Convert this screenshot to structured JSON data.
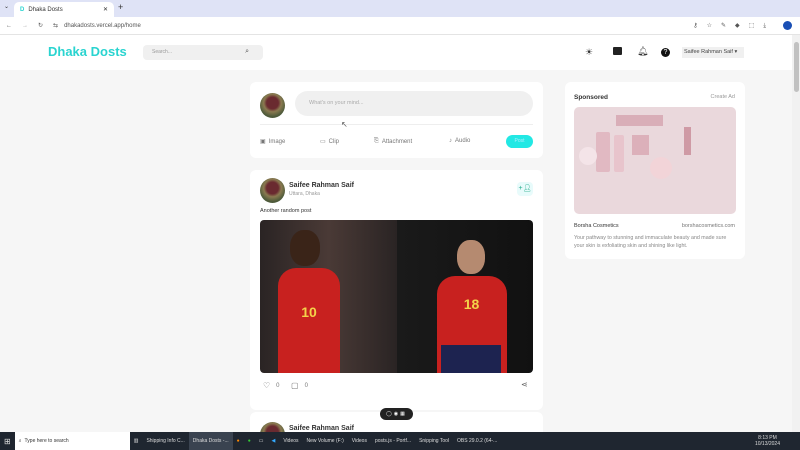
{
  "browser": {
    "tab_title": "Dhaka Dosts",
    "url": "dhakadosts.vercel.app/home"
  },
  "nav": {
    "logo": "Dhaka Dosts",
    "search_placeholder": "Search...",
    "user_name": "Saifee Rahman Saif"
  },
  "composer": {
    "placeholder": "What's on your mind...",
    "actions": [
      "Image",
      "Clip",
      "Attachment",
      "Audio"
    ],
    "post_label": "Post"
  },
  "posts": [
    {
      "author": "Saifee Rahman Saif",
      "location": "Uttara, Dhaka",
      "text": "Another random post",
      "likes": "0",
      "comments": "0"
    },
    {
      "author": "Saifee Rahman Saif"
    }
  ],
  "jersey_numbers": [
    "10",
    "18"
  ],
  "sponsored": {
    "title": "Sponsored",
    "create": "Create Ad",
    "brand": "Borsha Cosmetics",
    "site": "borshacosmetics.com",
    "desc": "Your pathway to stunning and immaculate beauty and made sure your skin is exfoliating skin and shining like light."
  },
  "taskbar": {
    "search": "Type here to search",
    "apps": [
      "Shipping Info C...",
      "Dhaka Dosts -...",
      "Videos",
      "New Volume (F:)",
      "Videos",
      "posts.js - Portf...",
      "Snipping Tool",
      "OBS 29.0.2 (64-..."
    ],
    "time": "8:13 PM",
    "date": "10/13/2024"
  }
}
